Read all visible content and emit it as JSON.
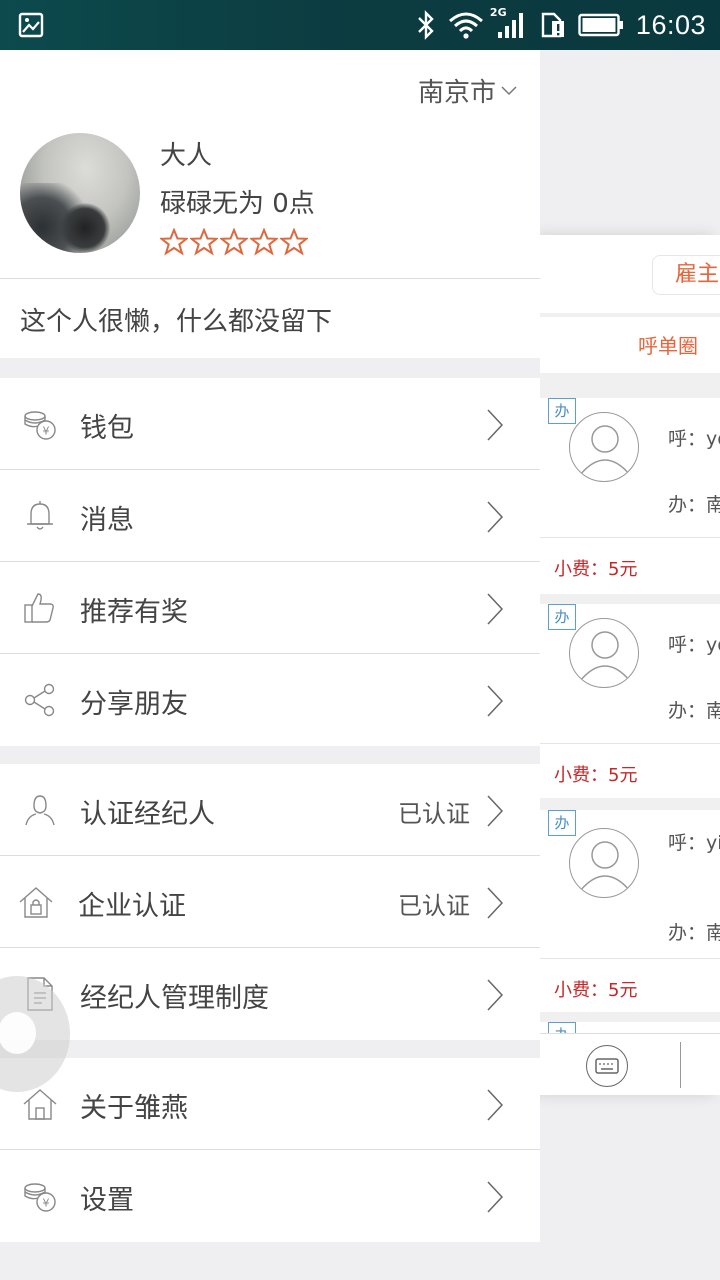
{
  "status_bar": {
    "time": "16:03",
    "network": "2G"
  },
  "drawer": {
    "city": "南京市",
    "user": {
      "name": "大人",
      "level_text": "碌碌无为 0点",
      "rating": 0,
      "max_rating": 5
    },
    "signature": "这个人很懒，什么都没留下",
    "menu_groups": [
      [
        {
          "label": "钱包",
          "icon": "coins-icon"
        },
        {
          "label": "消息",
          "icon": "bell-icon"
        },
        {
          "label": "推荐有奖",
          "icon": "thumbs-up-icon"
        },
        {
          "label": "分享朋友",
          "icon": "share-icon"
        }
      ],
      [
        {
          "label": "认证经纪人",
          "icon": "person-icon",
          "value": "已认证"
        },
        {
          "label": "企业认证",
          "icon": "house-lock-icon",
          "value": "已认证"
        },
        {
          "label": "经纪人管理制度",
          "icon": "document-icon"
        }
      ],
      [
        {
          "label": "关于雏燕",
          "icon": "home-icon"
        },
        {
          "label": "设置",
          "icon": "coins-icon"
        }
      ]
    ]
  },
  "background_page": {
    "tab": "雇主",
    "sub_tab": "呼单圈",
    "cards": [
      {
        "badge": "办",
        "hu": "呼：yo",
        "ban": "办：南",
        "fee": "小费：5元"
      },
      {
        "badge": "办",
        "hu": "呼：yo",
        "ban": "办：南",
        "fee": "小费：5元"
      },
      {
        "badge": "办",
        "hu": "呼：yi",
        "ban": "办：南",
        "fee": "小费：5元"
      }
    ],
    "partial_badge": "办"
  },
  "colors": {
    "accent": "#e8643a",
    "fee": "#c62828",
    "badge": "#4b8fc4",
    "status_bar": "#0c3b40"
  }
}
